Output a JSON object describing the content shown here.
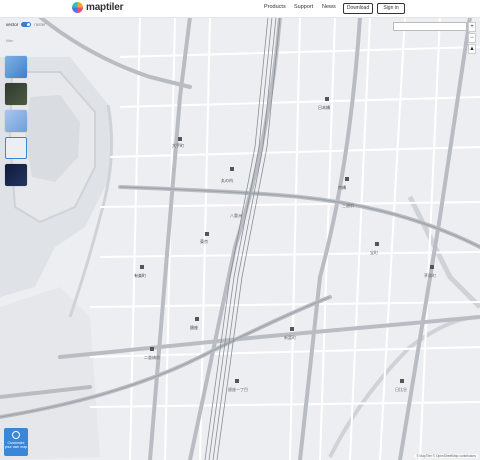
{
  "header": {
    "logo_text": "maptiler",
    "nav": [
      "Products",
      "Support",
      "News"
    ],
    "download_label": "Download",
    "signin_label": "Sign in"
  },
  "panel": {
    "toggle_left": "vector",
    "toggle_right": "raster",
    "filter_hint": "filter"
  },
  "customize_label": "Customize your own map",
  "attribution": "© MapTiler © OpenStreetMap contributors",
  "zoom_in": "+",
  "zoom_out": "−",
  "colors": {
    "map_bg": "#eceef1",
    "road_major": "#b9bdc3",
    "road_minor": "#ffffff",
    "park": "#dfe2e6",
    "water": "#cfd3d8",
    "accent": "#3a86d8"
  },
  "map_labels": {
    "l1": "大手町",
    "l2": "丸の内",
    "l3": "東京",
    "l4": "日本橋",
    "l5": "京橋",
    "l6": "八重洲",
    "l7": "有楽町",
    "l8": "銀座",
    "l9": "銀座一丁目",
    "l10": "新富町",
    "l11": "茅場町",
    "l12": "宝町",
    "l13": "二重橋前",
    "l14": "日比谷",
    "l15": "三越前"
  }
}
